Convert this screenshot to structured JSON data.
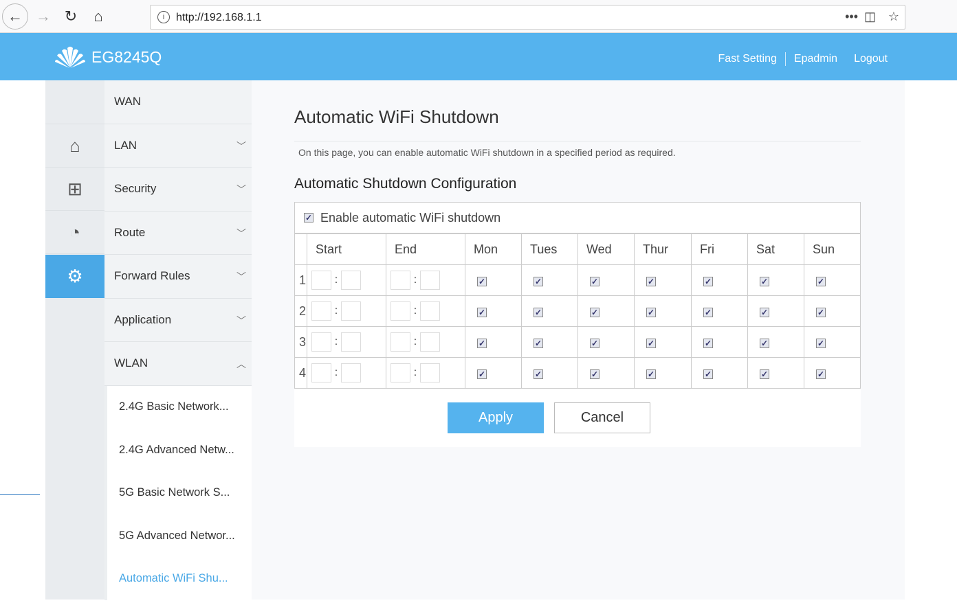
{
  "browser": {
    "url": "http://192.168.1.1"
  },
  "header": {
    "brand": "EG8245Q",
    "links": [
      "Fast Setting",
      "Epadmin",
      "Logout"
    ]
  },
  "sidebar": {
    "icons": [
      "home-icon",
      "add-box-icon",
      "diagnose-icon",
      "gear-icon"
    ],
    "items": [
      {
        "label": "WAN",
        "chevron": ""
      },
      {
        "label": "LAN",
        "chevron": "down"
      },
      {
        "label": "Security",
        "chevron": "down"
      },
      {
        "label": "Route",
        "chevron": "down"
      },
      {
        "label": "Forward Rules",
        "chevron": "down"
      },
      {
        "label": "Application",
        "chevron": "down"
      },
      {
        "label": "WLAN",
        "chevron": "up"
      }
    ],
    "subitems": [
      "2.4G Basic Network...",
      "2.4G Advanced Netw...",
      "5G Basic Network S...",
      "5G Advanced Networ...",
      "Automatic WiFi Shu..."
    ],
    "active_subitem": 4
  },
  "main": {
    "title": "Automatic WiFi Shutdown",
    "description": "On this page, you can enable automatic WiFi shutdown in a specified period as required.",
    "section": "Automatic Shutdown Configuration",
    "enable_label": "Enable automatic WiFi shutdown",
    "enable_checked": true,
    "columns": [
      "Start",
      "End",
      "Mon",
      "Tues",
      "Wed",
      "Thur",
      "Fri",
      "Sat",
      "Sun"
    ],
    "rows": [
      {
        "index": "1",
        "start_h": "",
        "start_m": "",
        "end_h": "",
        "end_m": "",
        "days": [
          true,
          true,
          true,
          true,
          true,
          true,
          true
        ]
      },
      {
        "index": "2",
        "start_h": "",
        "start_m": "",
        "end_h": "",
        "end_m": "",
        "days": [
          true,
          true,
          true,
          true,
          true,
          true,
          true
        ]
      },
      {
        "index": "3",
        "start_h": "",
        "start_m": "",
        "end_h": "",
        "end_m": "",
        "days": [
          true,
          true,
          true,
          true,
          true,
          true,
          true
        ]
      },
      {
        "index": "4",
        "start_h": "",
        "start_m": "",
        "end_h": "",
        "end_m": "",
        "days": [
          true,
          true,
          true,
          true,
          true,
          true,
          true
        ]
      }
    ],
    "time_separator": ":",
    "apply_label": "Apply",
    "cancel_label": "Cancel"
  },
  "colors": {
    "accent": "#55b3ee",
    "active_menu": "#4aa8e6"
  }
}
